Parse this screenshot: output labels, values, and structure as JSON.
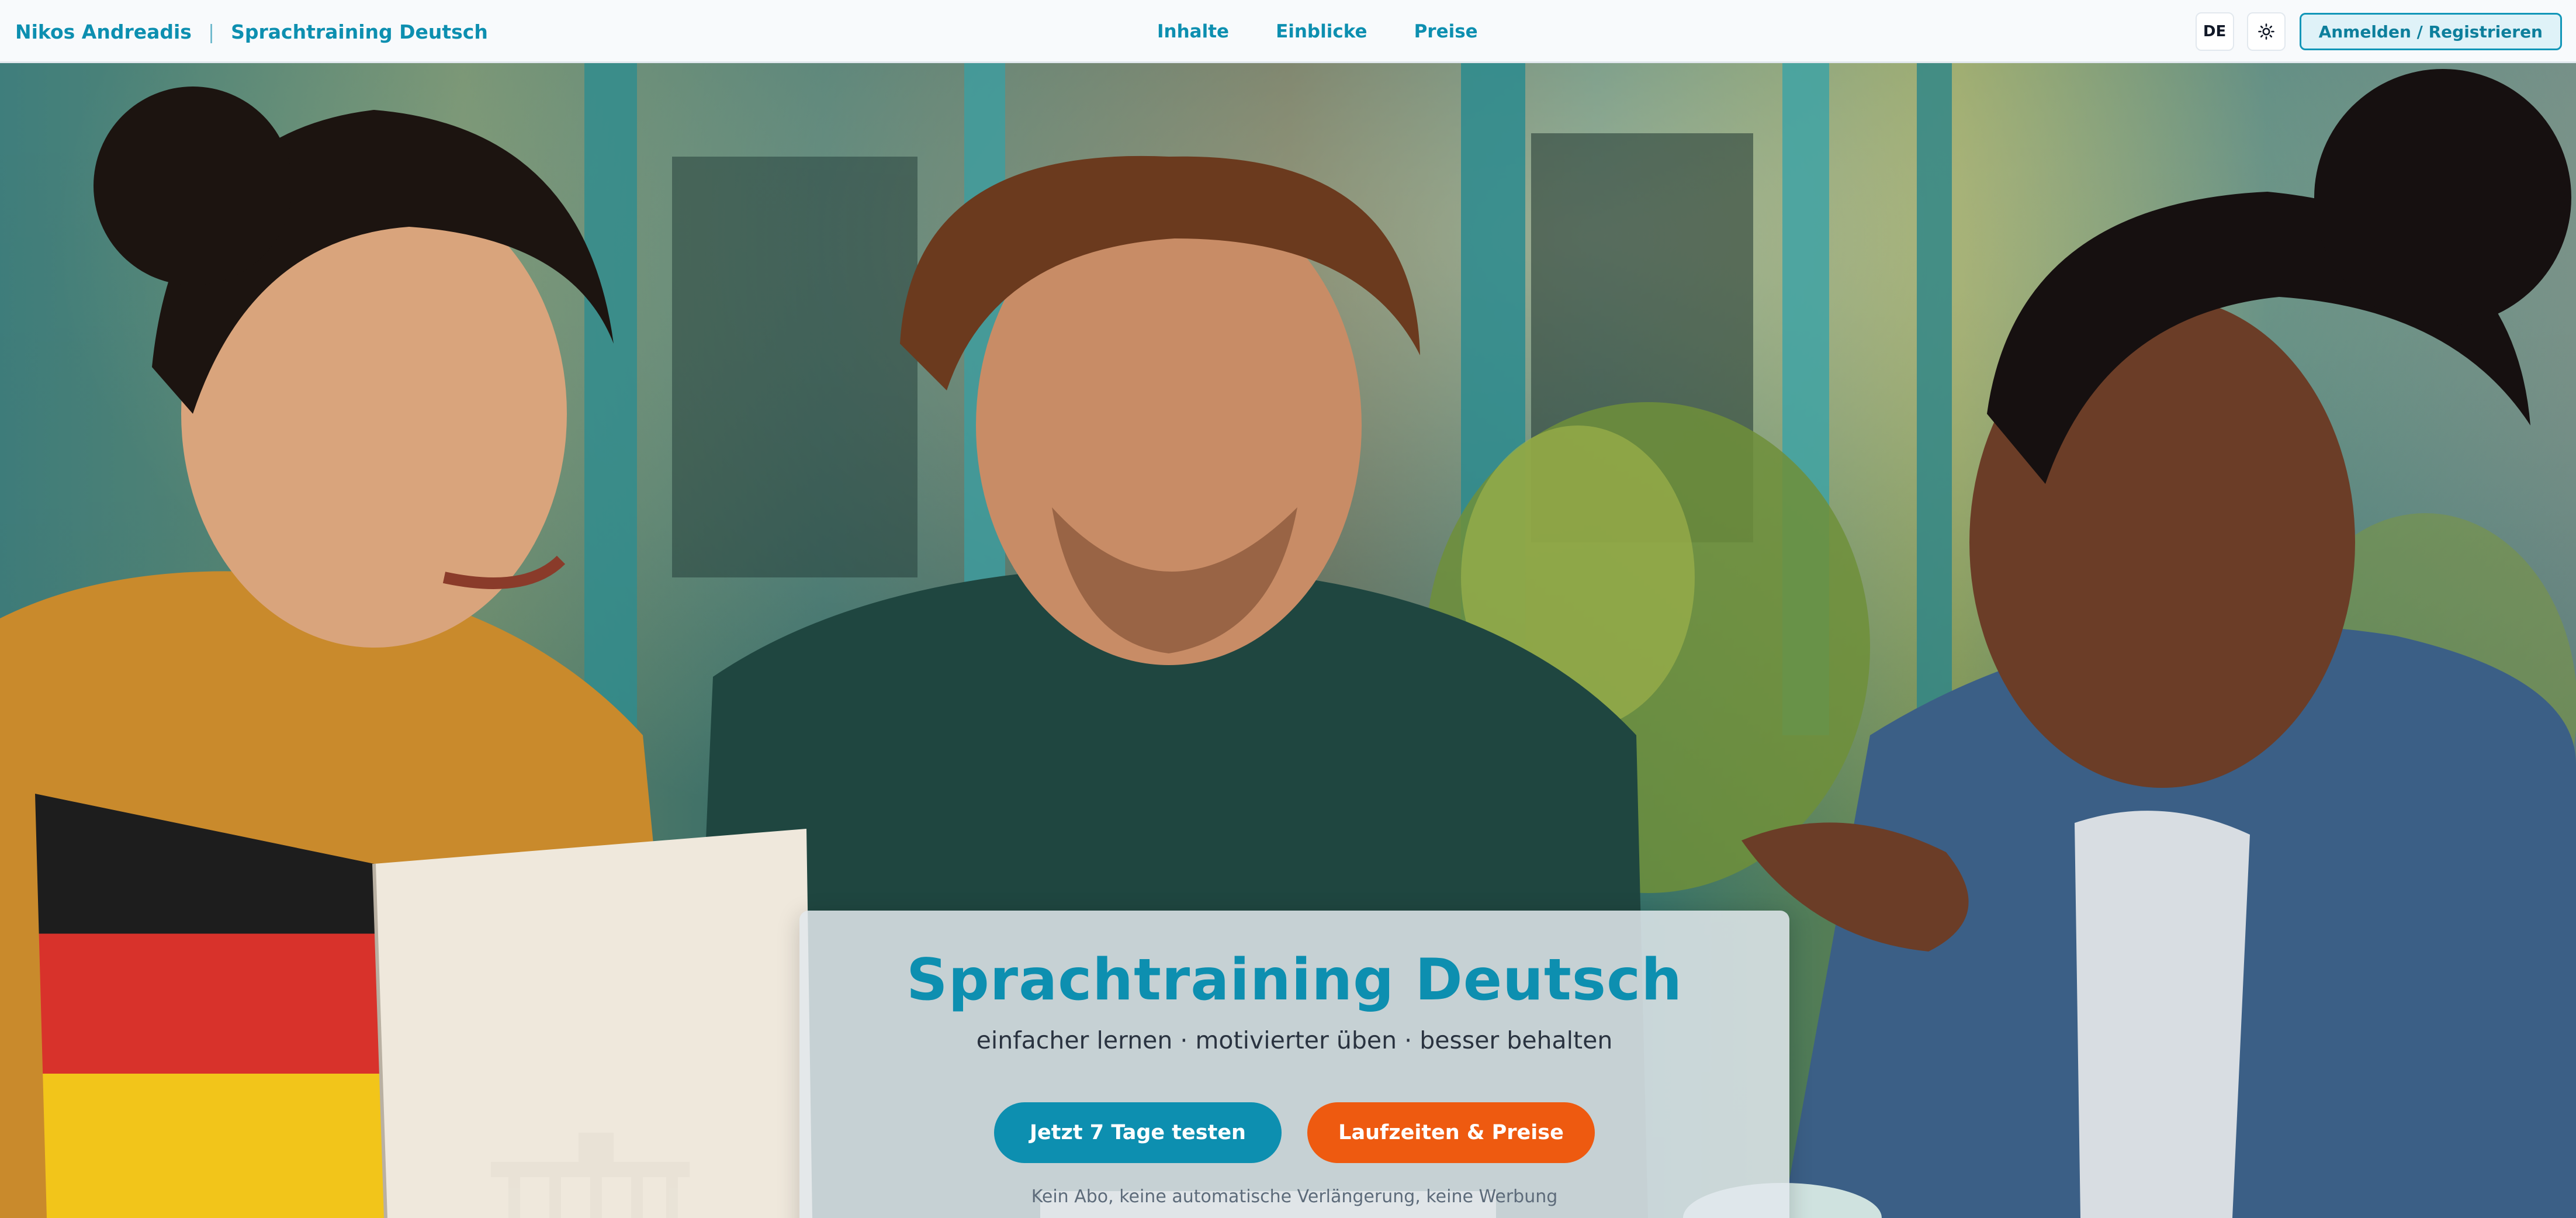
{
  "header": {
    "brand_name": "Nikos Andreadis",
    "brand_separator": "|",
    "brand_product": "Sprachtraining Deutsch",
    "nav": [
      {
        "label": "Inhalte"
      },
      {
        "label": "Einblicke"
      },
      {
        "label": "Preise"
      }
    ],
    "language": "DE",
    "theme_icon": "sun-icon",
    "login_label": "Anmelden / Registrieren"
  },
  "hero": {
    "image_icon": "hero-photo",
    "title": "Sprachtraining Deutsch",
    "subtitle": "einfacher lernen · motivierter üben · besser behalten",
    "cta_primary": "Jetzt 7 Tage testen",
    "cta_secondary": "Laufzeiten & Preise",
    "note": "Kein Abo, keine automatische Verlängerung, keine Werbung"
  },
  "colors": {
    "accent": "#0d8fb0",
    "cta_secondary": "#ee5a10",
    "nav_background": "#f8fafc"
  }
}
